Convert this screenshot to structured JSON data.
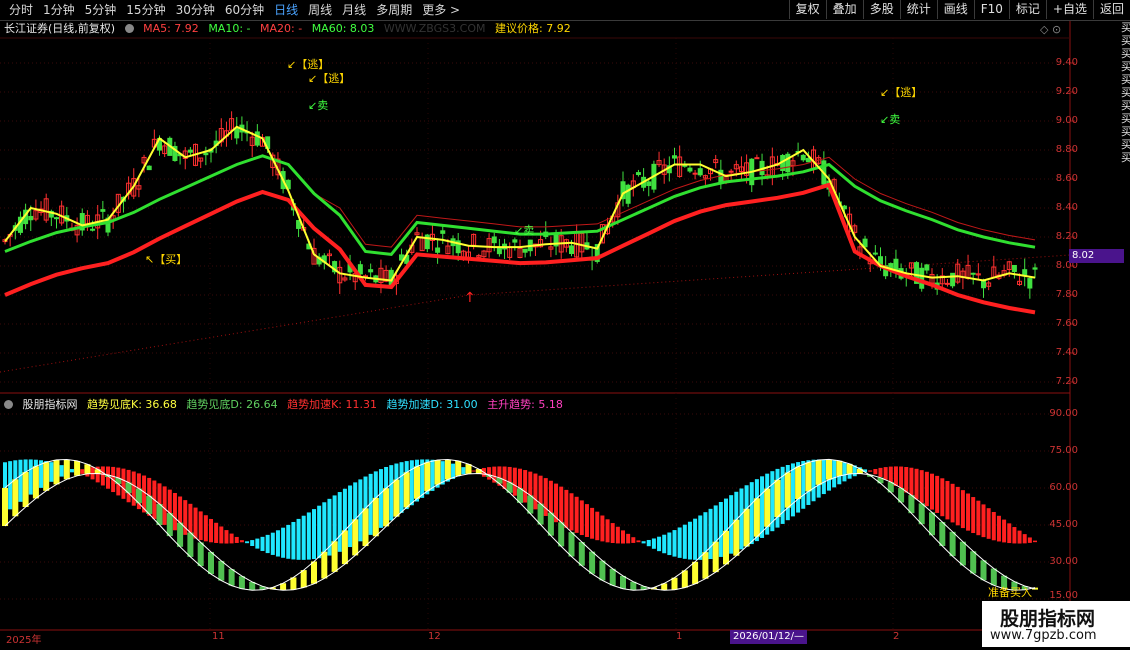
{
  "toolbar": {
    "periods": [
      "分时",
      "1分钟",
      "5分钟",
      "15分钟",
      "30分钟",
      "60分钟",
      "日线",
      "周线",
      "月线",
      "多周期",
      "更多 >"
    ],
    "active_period": "日线",
    "right_buttons": [
      "复权",
      "叠加",
      "多股",
      "统计",
      "画线",
      "F10",
      "标记",
      "+自选",
      "返回"
    ]
  },
  "main_header": {
    "title": "长江证券(日线,前复权)",
    "ma5": "MA5: 7.92",
    "ma10": "MA10: -",
    "ma20": "MA20: -",
    "ma60": "MA60: 8.03",
    "watermark": "WWW.ZBGS3.COM",
    "suggest": "建议价格: 7.92",
    "colors": {
      "ma5": "#ff4040",
      "ma10": "#40ff40",
      "ma20": "#ff4040",
      "ma60": "#40ff40",
      "suggest": "#ffd700"
    }
  },
  "main_marks": {
    "buy1": "↖【买】",
    "escape1": "↙【逃】",
    "escape2": "↙【逃】",
    "sell1": "↙卖",
    "sell2": "↙卖",
    "escape3": "↙【逃】",
    "sell3": "↙卖"
  },
  "price_axis": [
    "9.40",
    "9.20",
    "9.00",
    "8.80",
    "8.60",
    "8.40",
    "8.20",
    "8.00",
    "7.80",
    "7.60",
    "7.40",
    "7.20"
  ],
  "current_price": "8.02",
  "indicator_header": {
    "title": "股朋指标网",
    "k1": "趋势见底K: 36.68",
    "d1": "趋势见底D: 26.64",
    "k2": "趋势加速K: 11.31",
    "d2": "趋势加速D: 31.00",
    "main": "主升趋势: 5.18",
    "colors": {
      "k1": "#ffff40",
      "d1": "#60d060",
      "k2": "#ff3030",
      "d2": "#30e0ff",
      "main": "#ff40c0"
    }
  },
  "indicator_axis": [
    "90.00",
    "75.00",
    "60.00",
    "45.00",
    "30.00",
    "15.00"
  ],
  "ind_mark": "准备买入",
  "time_axis": {
    "ticks": [
      "2025年",
      "11",
      "12",
      "1",
      "2"
    ],
    "cursor_date": "2026/01/12/—"
  },
  "right_side_text": "买买买买买买买买买买买",
  "watermark": {
    "title": "股朋指标网",
    "url": "www.7gpzb.com"
  },
  "chart_data": {
    "type": "line",
    "title": "长江证券(日线,前复权)",
    "ylim": [
      7.15,
      9.5
    ],
    "x": [
      0,
      5,
      10,
      15,
      20,
      25,
      30,
      35,
      40,
      45,
      50,
      55,
      60,
      65,
      70,
      75,
      80,
      85,
      90,
      95,
      100,
      105,
      110,
      115,
      120,
      125,
      130,
      135,
      140,
      145,
      150,
      155,
      160,
      165,
      170,
      175,
      180,
      185,
      190,
      195,
      200
    ],
    "series": [
      {
        "name": "MA5",
        "values": [
          8.17,
          8.4,
          8.36,
          8.28,
          8.32,
          8.55,
          8.88,
          8.75,
          8.8,
          8.96,
          8.88,
          8.52,
          8.08,
          7.95,
          7.92,
          7.9,
          8.2,
          8.18,
          8.14,
          8.13,
          8.13,
          8.15,
          8.16,
          8.12,
          8.5,
          8.6,
          8.7,
          8.7,
          8.62,
          8.65,
          8.7,
          8.8,
          8.6,
          8.2,
          8.0,
          7.95,
          7.92,
          7.93,
          7.9,
          7.95,
          7.92
        ]
      },
      {
        "name": "MA60",
        "values": [
          8.0,
          8.07,
          8.13,
          8.17,
          8.2,
          8.27,
          8.36,
          8.44,
          8.52,
          8.6,
          8.66,
          8.6,
          8.4,
          8.25,
          8.0,
          7.98,
          8.2,
          8.18,
          8.16,
          8.14,
          8.12,
          8.12,
          8.13,
          8.14,
          8.22,
          8.3,
          8.38,
          8.44,
          8.48,
          8.5,
          8.52,
          8.55,
          8.6,
          8.45,
          8.35,
          8.28,
          8.22,
          8.15,
          8.1,
          8.06,
          8.03
        ]
      }
    ]
  }
}
